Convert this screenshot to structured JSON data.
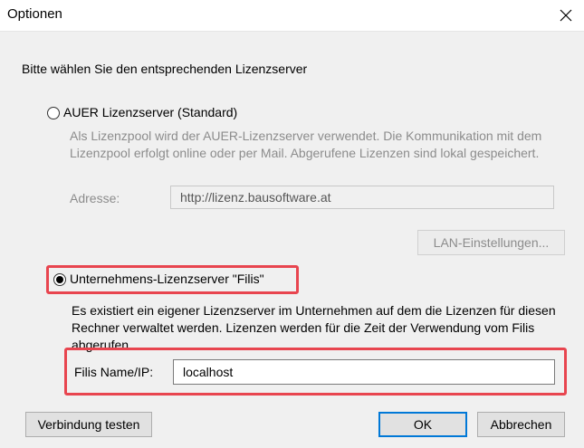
{
  "window": {
    "title": "Optionen"
  },
  "prompt": "Bitte wählen Sie den entsprechenden Lizenzserver",
  "auer": {
    "label": "AUER Lizenzserver (Standard)",
    "description": "Als Lizenzpool wird der AUER-Lizenzserver verwendet. Die Kommunikation mit dem Lizenzpool erfolgt online oder per Mail. Abgerufene Lizenzen sind lokal gespeichert.",
    "address_label": "Adresse:",
    "address_value": "http://lizenz.bausoftware.at",
    "lan_button": "LAN-Einstellungen..."
  },
  "filis": {
    "label": "Unternehmens-Lizenzserver \"Filis\"",
    "description": "Es existiert ein eigener Lizenzserver im Unternehmen auf dem die Lizenzen für diesen Rechner verwaltet werden. Lizenzen werden für die Zeit der Verwendung vom Filis abgerufen.",
    "name_label": "Filis Name/IP:",
    "name_value": "localhost"
  },
  "buttons": {
    "test": "Verbindung testen",
    "ok": "OK",
    "cancel": "Abbrechen"
  },
  "colors": {
    "highlight": "#e8454f",
    "accent": "#0078d7"
  }
}
